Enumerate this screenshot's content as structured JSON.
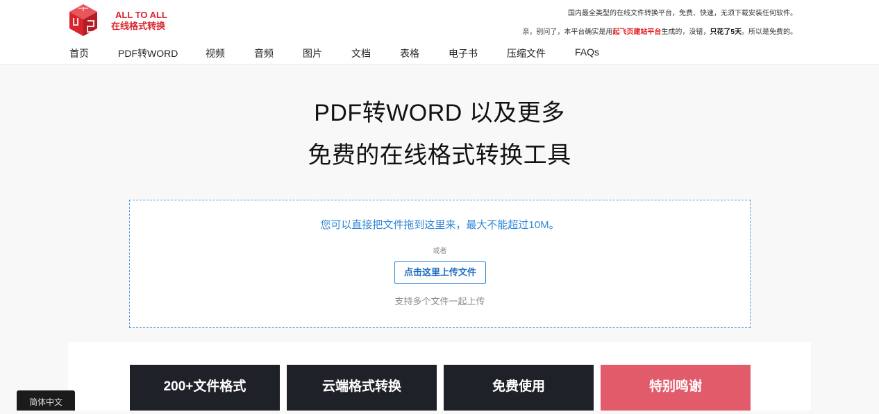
{
  "brand": {
    "name_en": "ALL TO ALL",
    "name_cn": "在线格式转换",
    "colors": {
      "red": "#d9232d",
      "blue": "#2f86d8",
      "dark": "#1f2128",
      "pink": "#e25b6b"
    }
  },
  "header": {
    "tagline1": "国内最全类型的在线文件转换平台，免费、快速，无须下载安装任何软件。",
    "tagline2_prefix": "亲，别问了，本平台确实是用",
    "tagline2_link": "起飞页建站平台",
    "tagline2_mid": "生成的，没错，",
    "tagline2_bold": "只花了5天",
    "tagline2_suffix": "。所以是免费的。"
  },
  "nav": {
    "items": [
      {
        "label": "首页"
      },
      {
        "label": "PDF转WORD"
      },
      {
        "label": "视频"
      },
      {
        "label": "音频"
      },
      {
        "label": "图片"
      },
      {
        "label": "文档"
      },
      {
        "label": "表格"
      },
      {
        "label": "电子书"
      },
      {
        "label": "压缩文件"
      },
      {
        "label": "FAQs"
      }
    ]
  },
  "hero": {
    "title1": "PDF转WORD 以及更多",
    "title2": "免费的在线格式转换工具"
  },
  "upload": {
    "hint": "您可以直接把文件拖到这里来，最大不能超过10M。",
    "or": "或者",
    "button": "点击这里上传文件",
    "multi": "支持多个文件一起上传"
  },
  "features": [
    {
      "label": "200+文件格式"
    },
    {
      "label": "云端格式转换"
    },
    {
      "label": "免费使用"
    },
    {
      "label": "特别鸣谢"
    }
  ],
  "language": {
    "label": "简体中文"
  }
}
